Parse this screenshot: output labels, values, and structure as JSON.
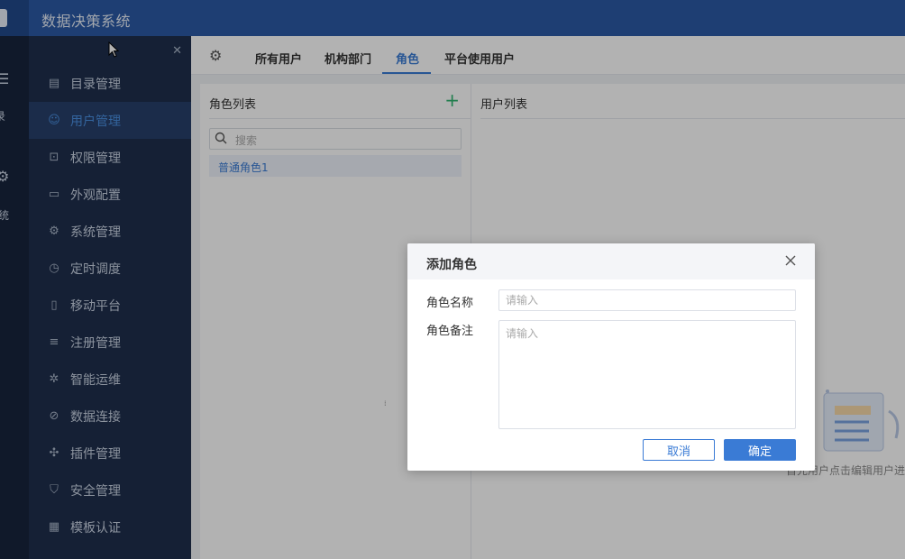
{
  "app": {
    "title": "数据决策系统"
  },
  "rail": {
    "items": [
      {
        "label": "录",
        "icon": "menu-icon"
      },
      {
        "label": "系统",
        "icon": "gear-icon"
      }
    ]
  },
  "sidebar": {
    "items": [
      {
        "label": "目录管理",
        "icon": "directory-icon"
      },
      {
        "label": "用户管理",
        "icon": "user-icon",
        "active": true
      },
      {
        "label": "权限管理",
        "icon": "lock-icon"
      },
      {
        "label": "外观配置",
        "icon": "paint-roller-icon"
      },
      {
        "label": "系统管理",
        "icon": "gear-icon"
      },
      {
        "label": "定时调度",
        "icon": "timer-icon"
      },
      {
        "label": "移动平台",
        "icon": "mobile-icon"
      },
      {
        "label": "注册管理",
        "icon": "register-icon"
      },
      {
        "label": "智能运维",
        "icon": "network-icon"
      },
      {
        "label": "数据连接",
        "icon": "link-icon"
      },
      {
        "label": "插件管理",
        "icon": "plugin-icon"
      },
      {
        "label": "安全管理",
        "icon": "shield-icon"
      },
      {
        "label": "模板认证",
        "icon": "template-icon"
      }
    ]
  },
  "tabs": [
    {
      "label": "所有用户"
    },
    {
      "label": "机构部门"
    },
    {
      "label": "角色",
      "active": true
    },
    {
      "label": "平台使用用户"
    }
  ],
  "role_panel": {
    "title": "角色列表",
    "search_placeholder": "搜索",
    "roles": [
      "普通角色1"
    ]
  },
  "user_panel": {
    "title": "用户列表",
    "empty_hint": "首先用户点击编辑用户进"
  },
  "dialog": {
    "title": "添加角色",
    "name_label": "角色名称",
    "name_placeholder": "请输入",
    "name_value": "",
    "remark_label": "角色备注",
    "remark_placeholder": "请输入",
    "remark_value": "",
    "cancel_label": "取消",
    "confirm_label": "确定"
  },
  "colors": {
    "header": "#2b5aa5",
    "sidebar": "#1f2f4d",
    "accent": "#3a7bd5",
    "add": "#2db36e"
  }
}
